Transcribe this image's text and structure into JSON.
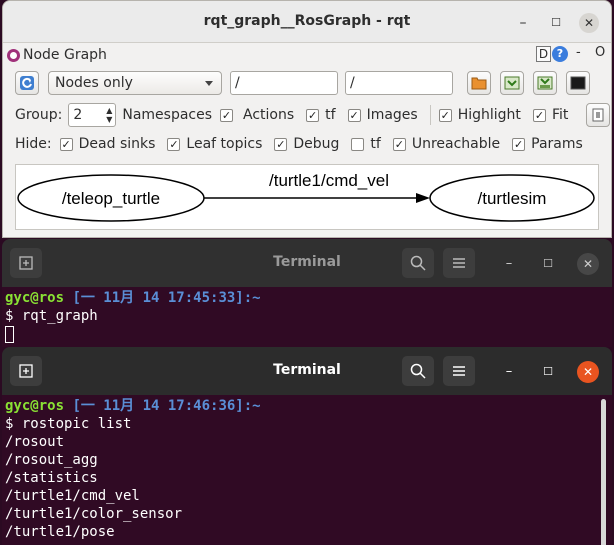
{
  "rqt": {
    "window_title": "rqt_graph__RosGraph - rqt",
    "plugin_title": "Node Graph",
    "plugin_ctrl_d": "D",
    "plugin_ctrl_help": "?",
    "plugin_ctrl_min": "-",
    "plugin_ctrl_close": "O",
    "toolbar": {
      "mode_select": "Nodes only",
      "filter1": "/",
      "filter2": "/"
    },
    "group_row": {
      "group_label": "Group:",
      "group_value": "2",
      "namespaces": "Namespaces",
      "actions": "Actions",
      "tf": "tf",
      "images": "Images",
      "highlight": "Highlight",
      "fit": "Fit"
    },
    "hide_row": {
      "hide_label": "Hide:",
      "dead_sinks": "Dead sinks",
      "leaf_topics": "Leaf topics",
      "debug": "Debug",
      "tf": "tf",
      "unreachable": "Unreachable",
      "params": "Params"
    },
    "checked": {
      "actions": true,
      "tf": true,
      "images": true,
      "highlight": true,
      "fit": true,
      "dead_sinks": true,
      "leaf_topics": true,
      "debug": true,
      "hide_tf": false,
      "unreachable": true,
      "params": true
    },
    "graph": {
      "node_left": "/teleop_turtle",
      "edge_label": "/turtle1/cmd_vel",
      "node_right": "/turtlesim"
    }
  },
  "terminal1": {
    "title": "Terminal",
    "user_host": "gyc@ros",
    "timestamp": "[一 11月 14 17:45:33]:~",
    "command": "$ rqt_graph"
  },
  "terminal2": {
    "title": "Terminal",
    "user_host": "gyc@ros",
    "timestamp": "[一 11月 14 17:46:36]:~",
    "command": "$ rostopic list",
    "output": [
      "/rosout",
      "/rosout_agg",
      "/statistics",
      "/turtle1/cmd_vel",
      "/turtle1/color_sensor",
      "/turtle1/pose"
    ]
  },
  "colors": {
    "terminal_bg": "#300a24",
    "prompt_user": "#8ae234",
    "prompt_path": "#5a8fd6",
    "close_accent": "#e95420"
  }
}
